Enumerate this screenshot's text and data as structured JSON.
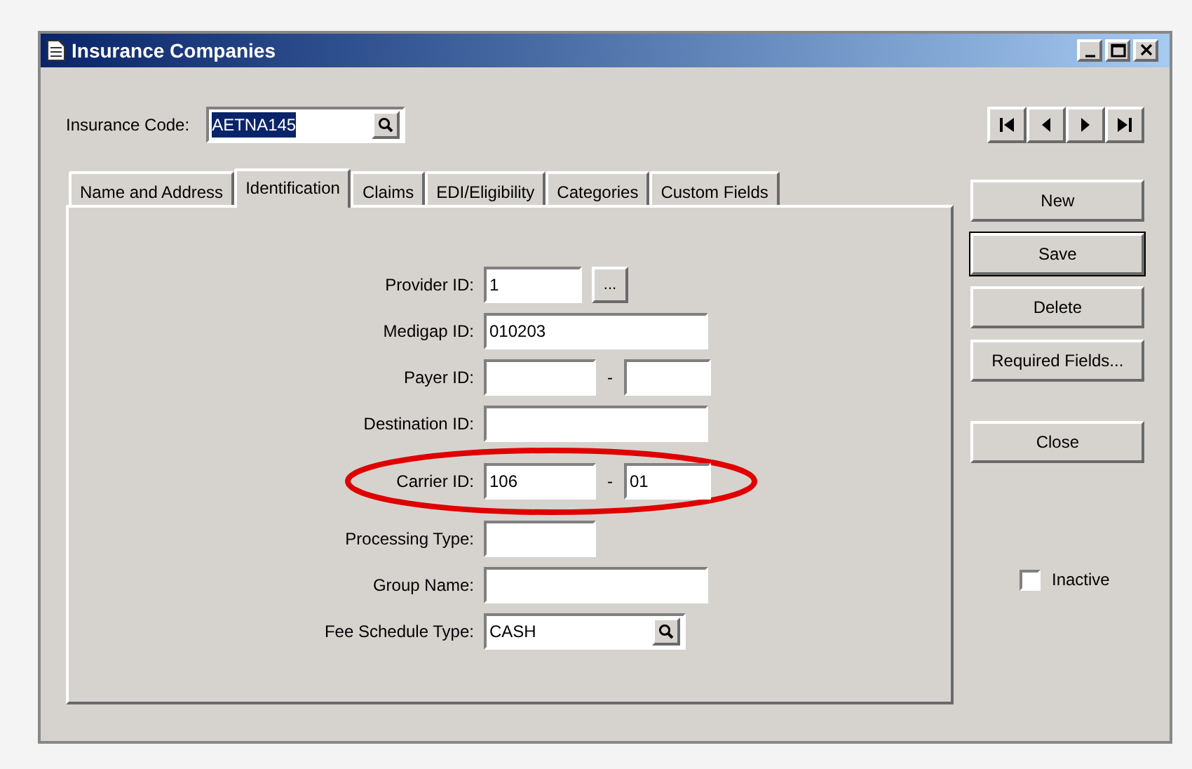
{
  "window": {
    "title": "Insurance Companies"
  },
  "insurance_code": {
    "label": "Insurance Code:",
    "value": "AETNA145",
    "selected": true
  },
  "tabs": [
    {
      "label": "Name and Address",
      "selected": false
    },
    {
      "label": "Identification",
      "selected": true
    },
    {
      "label": "Claims",
      "selected": false
    },
    {
      "label": "EDI/Eligibility",
      "selected": false
    },
    {
      "label": "Categories",
      "selected": false
    },
    {
      "label": "Custom Fields",
      "selected": false
    }
  ],
  "fields": [
    {
      "kind": "browse",
      "label": "Provider ID:",
      "value": "1",
      "button": "..."
    },
    {
      "kind": "wide",
      "label": "Medigap ID:",
      "value": "010203"
    },
    {
      "kind": "split",
      "label": "Payer ID:",
      "separator": "-"
    },
    {
      "kind": "wide",
      "label": "Destination ID:"
    },
    {
      "kind": "split",
      "label": "Carrier ID:",
      "value": "106",
      "separator": "-",
      "value_2": "01"
    },
    {
      "kind": "short",
      "label": "Processing Type:"
    },
    {
      "kind": "wide",
      "label": "Group Name:"
    },
    {
      "kind": "lookup",
      "label": "Fee Schedule Type:",
      "value": "CASH"
    }
  ],
  "buttons": [
    {
      "label": "New",
      "default": false
    },
    {
      "label": "Save",
      "default": true
    },
    {
      "label": "Delete",
      "default": false
    },
    {
      "label": "Required Fields...",
      "default": false
    },
    {
      "label": "Close",
      "default": false
    }
  ],
  "inactive": {
    "label": "Inactive",
    "checked": false
  }
}
